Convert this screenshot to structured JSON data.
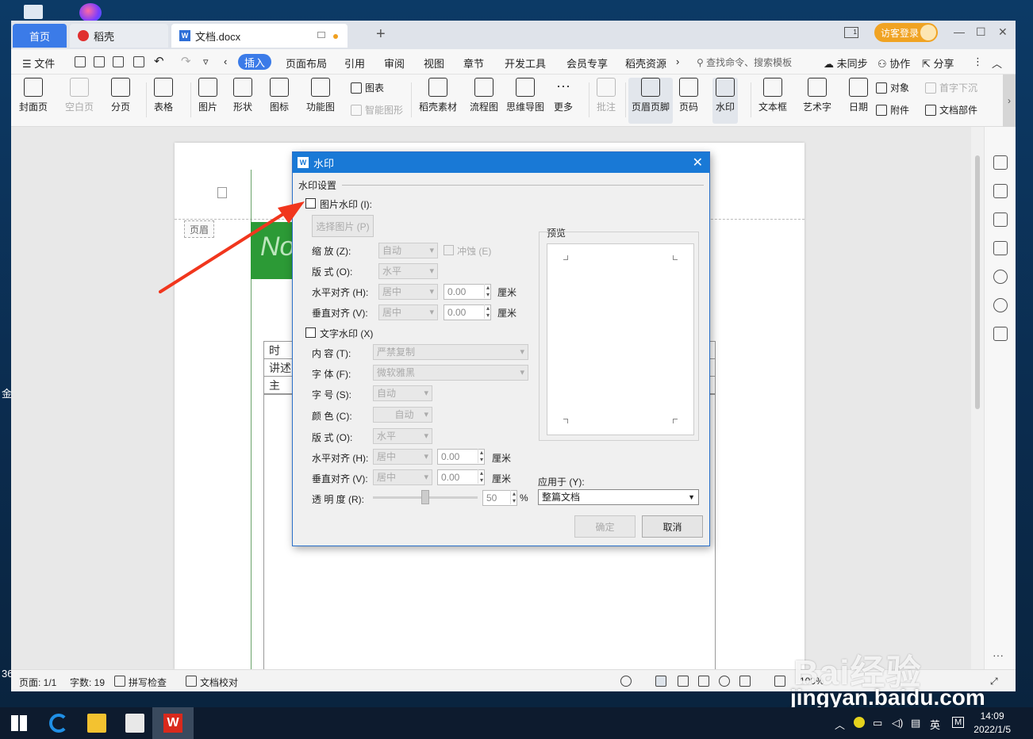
{
  "tabs": {
    "home": "首页",
    "daoke": "稻壳",
    "doc": "文档.docx"
  },
  "titlebar": {
    "login": "访客登录"
  },
  "menu": {
    "file": "文件",
    "items": [
      "插入",
      "页面布局",
      "引用",
      "审阅",
      "视图",
      "章节",
      "开发工具",
      "会员专享",
      "稻壳资源"
    ],
    "search": "查找命令、搜索模板",
    "sync": "未同步",
    "collab": "协作",
    "share": "分享"
  },
  "ribbon": {
    "cover": "封面页",
    "blank": "空白页",
    "pagebreak": "分页",
    "table": "表格",
    "picture": "图片",
    "shape": "形状",
    "icon": "图标",
    "funcpic": "功能图",
    "chart": "图表",
    "smartart": "智能图形",
    "daokeassets": "稻壳素材",
    "flowchart": "流程图",
    "mindmap": "思维导图",
    "more": "更多",
    "comment": "批注",
    "headerfooter": "页眉页脚",
    "pagenum": "页码",
    "watermark": "水印",
    "textbox": "文本框",
    "wordart": "艺术字",
    "date": "日期",
    "object": "对象",
    "attach": "附件",
    "dropcap": "首字下沉",
    "docparts": "文档部件"
  },
  "document": {
    "header_tag": "页眉",
    "green_text": "No",
    "rows": [
      "时",
      "讲述",
      "主"
    ]
  },
  "dialog": {
    "title": "水印",
    "group": "水印设置",
    "pic_wm": "图片水印 (I):",
    "choose_pic": "选择图片 (P)",
    "scale_lbl": "缩  放 (Z):",
    "scale_val": "自动",
    "washout": "冲蚀 (E)",
    "layout_lbl": "版  式 (O):",
    "layout_val": "水平",
    "halign_lbl": "水平对齐 (H):",
    "valign_lbl": "垂直对齐 (V):",
    "align_val": "居中",
    "offset_val": "0.00",
    "unit": "厘米",
    "text_wm": "文字水印 (X)",
    "content_lbl": "内  容 (T):",
    "content_val": "严禁复制",
    "font_lbl": "字  体 (F):",
    "font_val": "微软雅黑",
    "size_lbl": "字  号 (S):",
    "size_val": "自动",
    "color_lbl": "颜  色 (C):",
    "color_val": "自动",
    "tlayout_lbl": "版  式 (O):",
    "tlayout_val": "水平",
    "thalign_lbl": "水平对齐 (H):",
    "tvalign_lbl": "垂直对齐 (V):",
    "trans_lbl": "透 明 度 (R):",
    "trans_val": "50",
    "percent": "%",
    "preview": "预览",
    "apply_lbl": "应用于 (Y):",
    "apply_val": "整篇文档",
    "ok": "确定",
    "cancel": "取消"
  },
  "status": {
    "page": "页面: 1/1",
    "words": "字数: 19",
    "spell": "拼写检查",
    "proof": "文档校对",
    "zoom": "100%"
  },
  "taskbar": {
    "lang": "英",
    "time": "14:09",
    "date": "2022/1/5"
  },
  "watermark_site": {
    "logo": "Bai经验",
    "url": "jingyan.baidu.com"
  }
}
